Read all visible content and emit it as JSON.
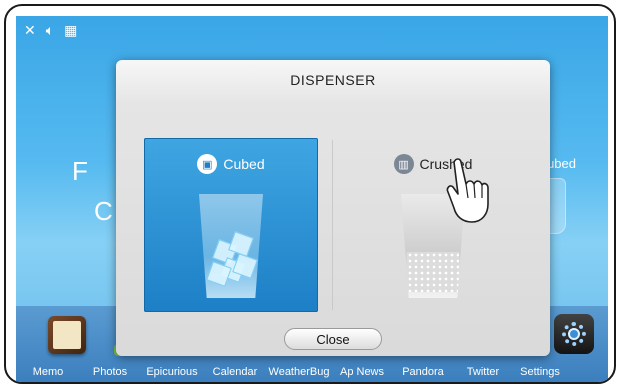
{
  "status_bar": {
    "icons": [
      "close-icon",
      "volume-icon",
      "wifi-icon"
    ]
  },
  "background": {
    "left_fragment_1": "F",
    "left_fragment_2": "C",
    "right_label": "Cubed"
  },
  "dialog": {
    "title": "DISPENSER",
    "options": [
      {
        "label": "Cubed",
        "icon": "cubed-glass-icon",
        "selected": true
      },
      {
        "label": "Crushed",
        "icon": "crushed-glass-icon",
        "selected": false
      }
    ],
    "close_label": "Close"
  },
  "dock": {
    "apps": [
      {
        "label": "Memo",
        "icon": "memo-icon"
      },
      {
        "label": "Photos",
        "icon": "photos-icon"
      },
      {
        "label": "Epicurious",
        "icon": "epicurious-icon"
      },
      {
        "label": "Calendar",
        "icon": "calendar-icon"
      },
      {
        "label": "WeatherBug",
        "icon": "weatherbug-icon"
      },
      {
        "label": "Ap News",
        "icon": "ap-news-icon"
      },
      {
        "label": "Pandora",
        "icon": "pandora-icon"
      },
      {
        "label": "Twitter",
        "icon": "twitter-icon"
      },
      {
        "label": "Settings",
        "icon": "settings-icon"
      }
    ]
  },
  "colors": {
    "selected_panel": "#1d7fc6",
    "screen_background": "#56baf0"
  }
}
